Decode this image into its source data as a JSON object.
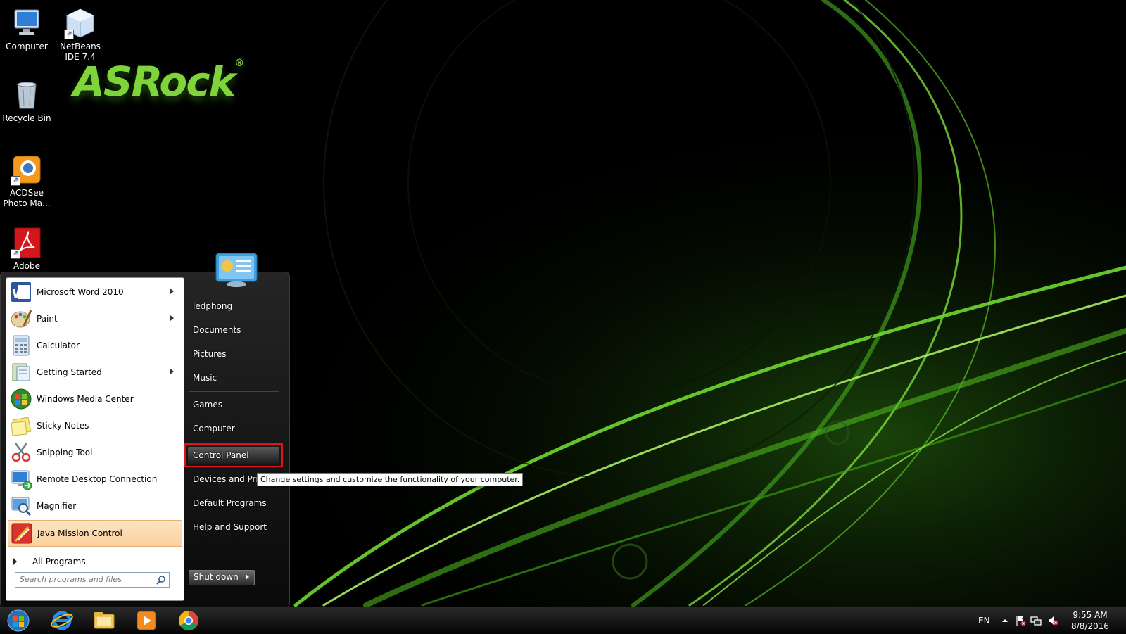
{
  "desktop": {
    "brand": "ASRock",
    "brand_mark": "®",
    "icons": [
      {
        "label": "Computer"
      },
      {
        "label": "NetBeans IDE 7.4"
      },
      {
        "label": "Recycle Bin"
      },
      {
        "label": "ACDSee Photo Ma..."
      },
      {
        "label": "Adobe"
      }
    ]
  },
  "start_menu": {
    "programs": [
      {
        "label": "Microsoft Word 2010",
        "icon": "word-icon",
        "has_submenu": true
      },
      {
        "label": "Paint",
        "icon": "paint-icon",
        "has_submenu": true
      },
      {
        "label": "Calculator",
        "icon": "calculator-icon",
        "has_submenu": false
      },
      {
        "label": "Getting Started",
        "icon": "getting-started-icon",
        "has_submenu": true
      },
      {
        "label": "Windows Media Center",
        "icon": "media-center-icon",
        "has_submenu": false
      },
      {
        "label": "Sticky Notes",
        "icon": "sticky-notes-icon",
        "has_submenu": false
      },
      {
        "label": "Snipping Tool",
        "icon": "snipping-tool-icon",
        "has_submenu": false
      },
      {
        "label": "Remote Desktop Connection",
        "icon": "remote-desktop-icon",
        "has_submenu": false
      },
      {
        "label": "Magnifier",
        "icon": "magnifier-icon",
        "has_submenu": false
      },
      {
        "label": "Java Mission Control",
        "icon": "java-mission-control-icon",
        "has_submenu": false,
        "highlighted": true
      }
    ],
    "all_programs": "All Programs",
    "search_placeholder": "Search programs and files",
    "right_items": [
      {
        "label": "ledphong"
      },
      {
        "label": "Documents"
      },
      {
        "label": "Pictures"
      },
      {
        "label": "Music"
      },
      {
        "label": "Games"
      },
      {
        "label": "Computer"
      },
      {
        "label": "Control Panel"
      },
      {
        "label": "Devices and Prin"
      },
      {
        "label": "Default Programs"
      },
      {
        "label": "Help and Support"
      }
    ],
    "tooltip": "Change settings and customize the functionality of your computer.",
    "shutdown": "Shut down"
  },
  "taskbar": {
    "apps": [
      "start-orb-icon",
      "internet-explorer-icon",
      "file-explorer-icon",
      "media-player-icon",
      "chrome-icon"
    ],
    "language": "EN",
    "time": "9:55 AM",
    "date": "8/8/2016"
  },
  "colors": {
    "highlight_border": "#e0121a",
    "accent_green": "#7fd43a"
  }
}
